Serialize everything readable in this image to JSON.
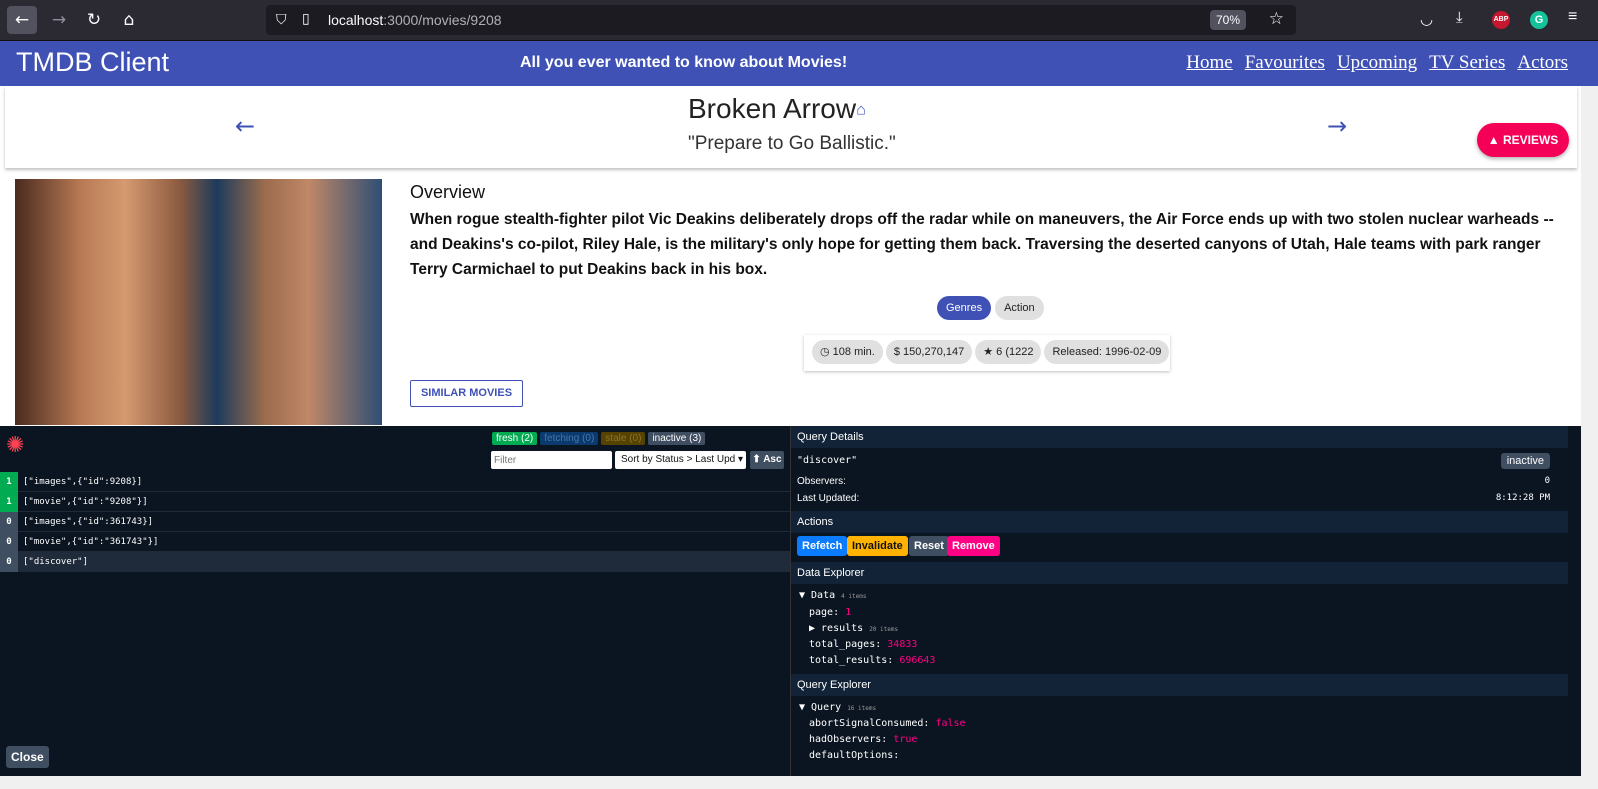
{
  "browser": {
    "url_host": "localhost",
    "url_path": ":3000/movies/9208",
    "zoom": "70%"
  },
  "app": {
    "brand": "TMDB Client",
    "tagline": "All you ever wanted to know about Movies!",
    "nav": [
      "Home",
      "Favourites",
      "Upcoming",
      "TV Series",
      "Actors"
    ]
  },
  "movie": {
    "title": "Broken Arrow",
    "tagline": "\"Prepare to Go Ballistic.\"",
    "reviews_label": "REVIEWS",
    "overview_heading": "Overview",
    "overview": "When rogue stealth-fighter pilot Vic Deakins deliberately drops off the radar while on maneuvers, the Air Force ends up with two stolen nuclear warheads -- and Deakins's co-pilot, Riley Hale, is the military's only hope for getting them back. Traversing the deserted canyons of Utah, Hale teams with park ranger Terry Carmichael to put Deakins back in his box.",
    "genres_label": "Genres",
    "genre": "Action",
    "runtime": "108 min.",
    "revenue": "150,270,147",
    "rating": "6 (1222",
    "released": "Released: 1996-02-09",
    "similar_label": "SIMILAR MOVIES"
  },
  "devtools": {
    "badges": {
      "fresh": "fresh",
      "fresh_n": "(2)",
      "fetching": "fetching",
      "fetching_n": "(0)",
      "stale": "stale",
      "stale_n": "(0)",
      "inactive": "inactive",
      "inactive_n": "(3)"
    },
    "filter_placeholder": "Filter",
    "sort": "Sort by Status > Last Upd",
    "asc": "⬆ Asc",
    "queries": [
      {
        "count": "1",
        "key": "[\"images\",{\"id\":9208}]"
      },
      {
        "count": "1",
        "key": "[\"movie\",{\"id\":\"9208\"}]"
      },
      {
        "count": "0",
        "key": "[\"images\",{\"id\":361743}]"
      },
      {
        "count": "0",
        "key": "[\"movie\",{\"id\":\"361743\"}]"
      },
      {
        "count": "0",
        "key": "[\"discover\"]"
      }
    ],
    "close": "Close",
    "details": {
      "heading": "Query Details",
      "key": "\"discover\"",
      "status": "inactive",
      "observers_label": "Observers:",
      "observers": "0",
      "updated_label": "Last Updated:",
      "updated": "8:12:28 PM"
    },
    "actions": {
      "heading": "Actions",
      "refetch": "Refetch",
      "invalidate": "Invalidate",
      "reset": "Reset",
      "remove": "Remove"
    },
    "explorer": {
      "heading": "Data Explorer",
      "root": "▼ Data",
      "root_count": "4 items",
      "page_k": "page:",
      "page_v": "1",
      "results_k": "▶ results",
      "results_count": "20 items",
      "tp_k": "total_pages:",
      "tp_v": "34833",
      "tr_k": "total_results:",
      "tr_v": "696643"
    },
    "qexplorer": {
      "heading": "Query Explorer",
      "root": "▼ Query",
      "root_count": "16 items",
      "a_k": "abortSignalConsumed:",
      "a_v": "false",
      "h_k": "hadObservers:",
      "h_v": "true",
      "d_k": "defaultOptions:"
    }
  }
}
